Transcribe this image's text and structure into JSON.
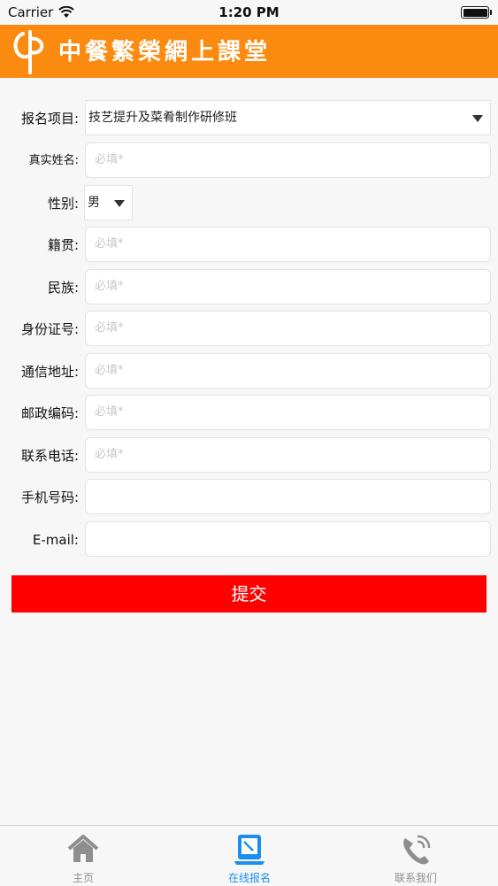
{
  "status_bar": {
    "carrier": "Carrier",
    "time": "1:20 PM"
  },
  "header": {
    "title": "中餐繁榮網上課堂"
  },
  "form": {
    "project": {
      "label": "报名项目:",
      "value": "技艺提升及菜肴制作研修班"
    },
    "name": {
      "label": "真实姓名:",
      "placeholder": "必填*"
    },
    "gender": {
      "label": "性别:",
      "value": "男"
    },
    "hometown": {
      "label": "籍贯:",
      "placeholder": "必填*"
    },
    "ethnicity": {
      "label": "民族:",
      "placeholder": "必填*"
    },
    "id_number": {
      "label": "身份证号:",
      "placeholder": "必填*"
    },
    "address": {
      "label": "通信地址:",
      "placeholder": "必填*"
    },
    "postcode": {
      "label": "邮政编码:",
      "placeholder": "必填*"
    },
    "phone": {
      "label": "联系电话:",
      "placeholder": "必填*"
    },
    "mobile": {
      "label": "手机号码:",
      "placeholder": ""
    },
    "email": {
      "label": "E-mail:",
      "placeholder": ""
    },
    "submit_label": "提交"
  },
  "tabbar": {
    "tabs": [
      {
        "label": "主页",
        "icon": "home-icon",
        "active": false
      },
      {
        "label": "在线报名",
        "icon": "tablet-icon",
        "active": true
      },
      {
        "label": "联系我们",
        "icon": "phone-icon",
        "active": false
      }
    ]
  },
  "colors": {
    "header": "#fb8b10",
    "submit": "#fe0000",
    "active_tab": "#1b8ef0"
  }
}
